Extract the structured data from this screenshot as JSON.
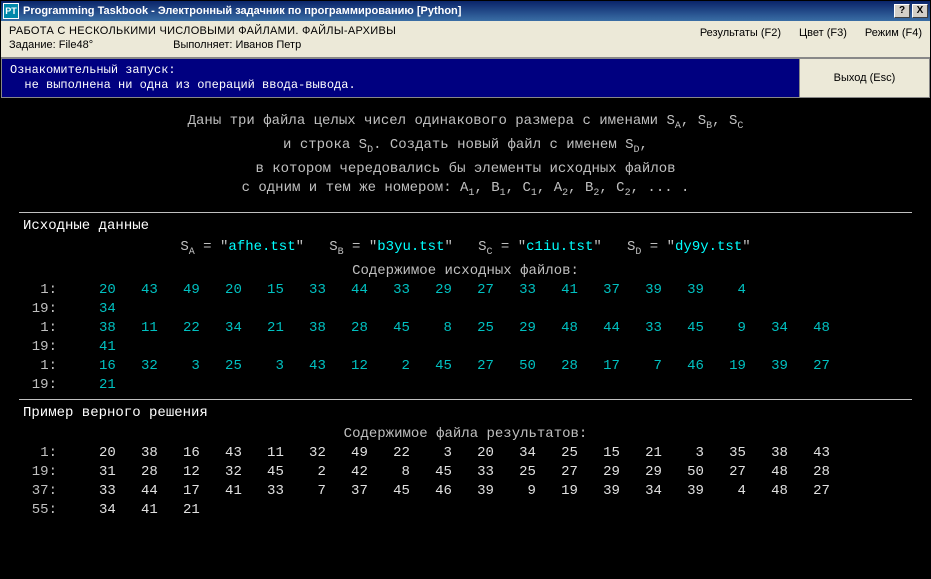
{
  "titlebar": {
    "title": "Programming Taskbook - Электронный задачник по программированию [Python]",
    "help": "?",
    "close": "X"
  },
  "header": {
    "topic": "РАБОТА С НЕСКОЛЬКИМИ ЧИСЛОВЫМИ ФАЙЛАМИ. ФАЙЛЫ-АРХИВЫ",
    "task": "Задание: File48°",
    "runner": "Выполняет: Иванов Петр",
    "results": "Результаты (F2)",
    "color": "Цвет (F3)",
    "mode": "Режим (F4)"
  },
  "status": {
    "line1": "Ознакомительный запуск:",
    "line2": "  не выполнена ни одна из операций ввода-вывода.",
    "exit": "Выход (Esc)"
  },
  "problem": {
    "l1a": "Даны три файла целых чисел одинакового размера с именами S",
    "l1b": ", S",
    "l1c": ", S",
    "l2a": "и строка S",
    "l2b": ". Создать новый файл с именем S",
    "l2c": ",",
    "l3": "в котором чередовались бы элементы исходных файлов",
    "l4": "с одним и тем же номером: A",
    "l4b": ", B",
    "l4c": ", C",
    "l4d": ", A",
    "l4e": ", B",
    "l4f": ", C",
    "l4g": ", ... ."
  },
  "input": {
    "title": "Исходные данные",
    "files": {
      "sa": "afhe.tst",
      "sb": "b3yu.tst",
      "sc": "c1iu.tst",
      "sd": "dy9y.tst",
      "la": "S",
      "lb": "S",
      "lc": "S",
      "ld": "S",
      "eq": " = ",
      "q": "\""
    },
    "content_title": "Содержимое исходных файлов:",
    "rows": [
      {
        "ln": "1:",
        "v": [
          20,
          43,
          49,
          20,
          15,
          33,
          44,
          33,
          29,
          27,
          33,
          41,
          37,
          39,
          39,
          4
        ],
        "c": "cy"
      },
      {
        "ln": "19:",
        "v": [
          34
        ],
        "c": "cy"
      },
      {
        "ln": "1:",
        "v": [
          38,
          11,
          22,
          34,
          21,
          38,
          28,
          45,
          8,
          25,
          29,
          48,
          44,
          33,
          45,
          9,
          34,
          48
        ],
        "c": "cy"
      },
      {
        "ln": "19:",
        "v": [
          41
        ],
        "c": "cy"
      },
      {
        "ln": "1:",
        "v": [
          16,
          32,
          3,
          25,
          3,
          43,
          12,
          2,
          45,
          27,
          50,
          28,
          17,
          7,
          46,
          19,
          39,
          27
        ],
        "c": "cy"
      },
      {
        "ln": "19:",
        "v": [
          21
        ],
        "c": "cy"
      }
    ]
  },
  "output": {
    "title": "Пример верного решения",
    "content_title": "Содержимое файла результатов:",
    "rows": [
      {
        "ln": "1:",
        "v": [
          20,
          38,
          16,
          43,
          11,
          32,
          49,
          22,
          3,
          20,
          34,
          25,
          15,
          21,
          3,
          35,
          38,
          43
        ],
        "c": "wh"
      },
      {
        "ln": "19:",
        "v": [
          31,
          28,
          12,
          32,
          45,
          2,
          42,
          8,
          45,
          33,
          25,
          27,
          29,
          29,
          50,
          27,
          48,
          28
        ],
        "c": "wh"
      },
      {
        "ln": "37:",
        "v": [
          33,
          44,
          17,
          41,
          33,
          7,
          37,
          45,
          46,
          39,
          9,
          19,
          39,
          34,
          39,
          4,
          48,
          27
        ],
        "c": "wh"
      },
      {
        "ln": "55:",
        "v": [
          34,
          41,
          21
        ],
        "c": "wh"
      }
    ]
  }
}
